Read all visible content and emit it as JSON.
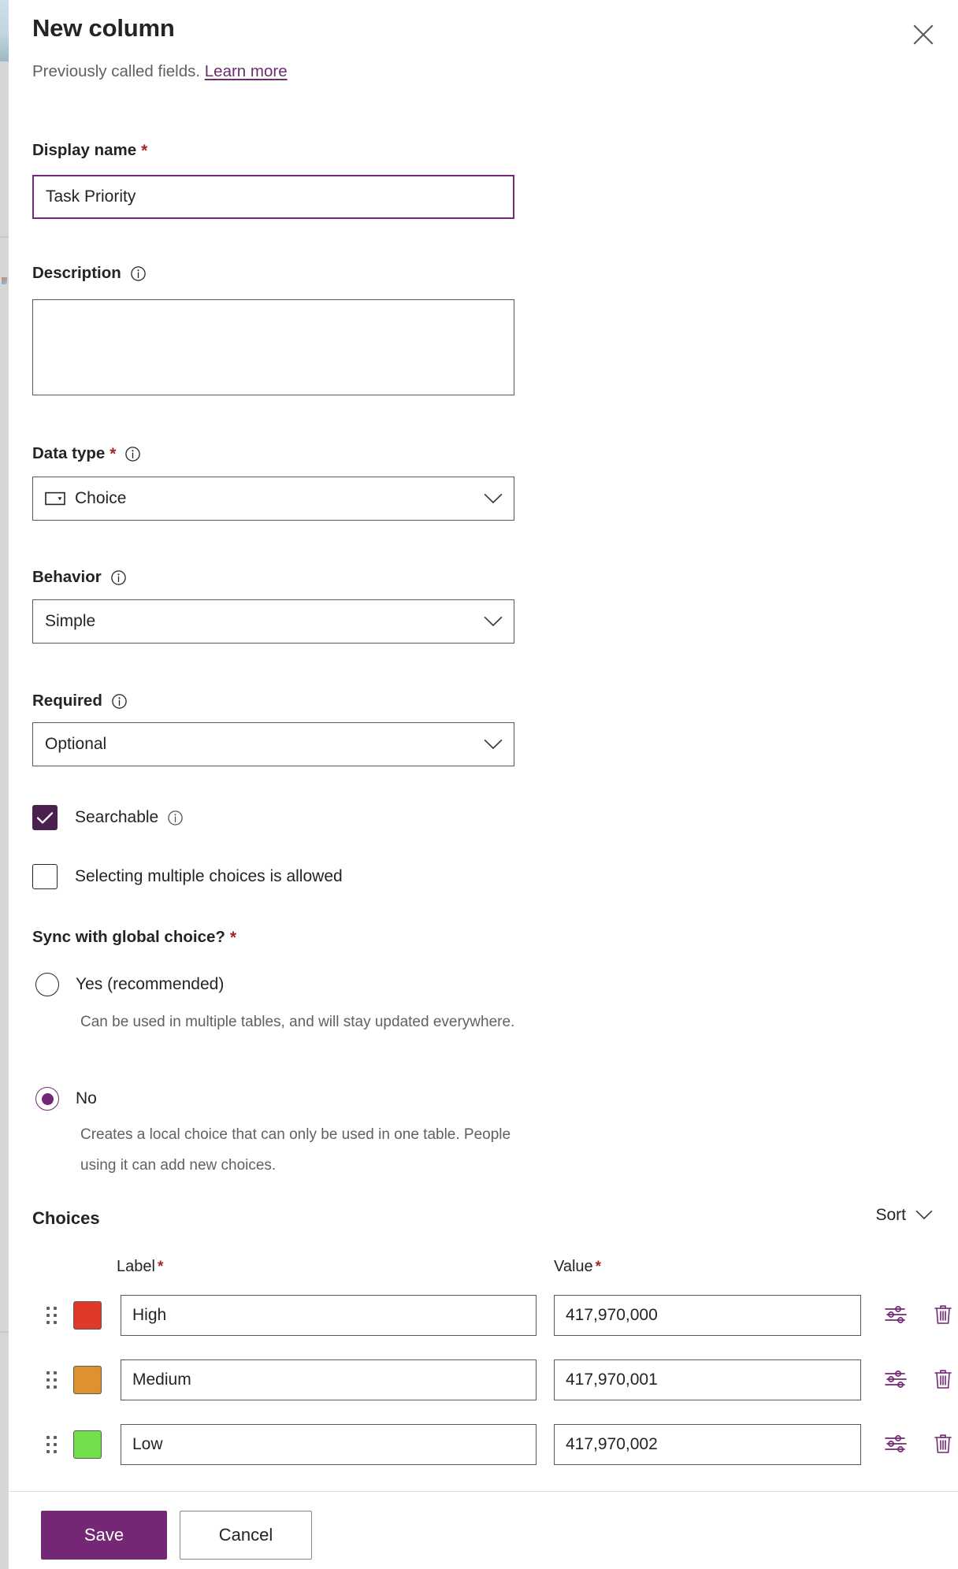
{
  "panel": {
    "title": "New column",
    "subtitle_text": "Previously called fields.",
    "subtitle_link": "Learn more",
    "close_icon": "close-icon"
  },
  "fields": {
    "display_name": {
      "label": "Display name",
      "required_marker": "*",
      "value": "Task Priority",
      "placeholder": ""
    },
    "description": {
      "label": "Description",
      "info_icon": "info-icon",
      "value": "",
      "placeholder": ""
    },
    "data_type": {
      "label": "Data type",
      "required_marker": "*",
      "info_icon": "info-icon",
      "selected": "Choice",
      "lead_icon": "choice-icon",
      "chevron": "chevron-down-icon"
    },
    "behavior": {
      "label": "Behavior",
      "info_icon": "info-icon",
      "selected": "Simple",
      "chevron": "chevron-down-icon"
    },
    "required": {
      "label": "Required",
      "info_icon": "info-icon",
      "selected": "Optional",
      "chevron": "chevron-down-icon"
    },
    "searchable": {
      "label": "Searchable",
      "checked": true,
      "info_icon": "info-icon"
    },
    "multi_select": {
      "label": "Selecting multiple choices is allowed",
      "checked": false
    }
  },
  "sync_global": {
    "label": "Sync with global choice?",
    "required_marker": "*",
    "options": [
      {
        "label": "Yes (recommended)",
        "help": "Can be used in multiple tables, and will stay updated everywhere.",
        "selected": false
      },
      {
        "label": "No",
        "help": "Creates a local choice that can only be used in one table. People using it can add new choices.",
        "selected": true
      }
    ]
  },
  "choices": {
    "title": "Choices",
    "sort_label": "Sort",
    "sort_chevron": "chevron-down-icon",
    "columns": {
      "label": "Label",
      "label_required": "*",
      "value": "Value",
      "value_required": "*"
    },
    "rows": [
      {
        "color": "#e0392a",
        "label": "High",
        "value": "417,970,000"
      },
      {
        "color": "#e0912f",
        "label": "Medium",
        "value": "417,970,001"
      },
      {
        "color": "#72e04a",
        "label": "Low",
        "value": "417,970,002"
      }
    ],
    "row_actions": {
      "settings_icon": "sliders-settings-icon",
      "delete_icon": "trash-delete-icon"
    }
  },
  "footer": {
    "save_label": "Save",
    "cancel_label": "Cancel"
  },
  "colors": {
    "accent_purple": "#742774",
    "checkbox_purple": "#4b1f4e",
    "required_red": "#a4262c",
    "border_gray": "#595959",
    "muted_text": "#616161"
  }
}
